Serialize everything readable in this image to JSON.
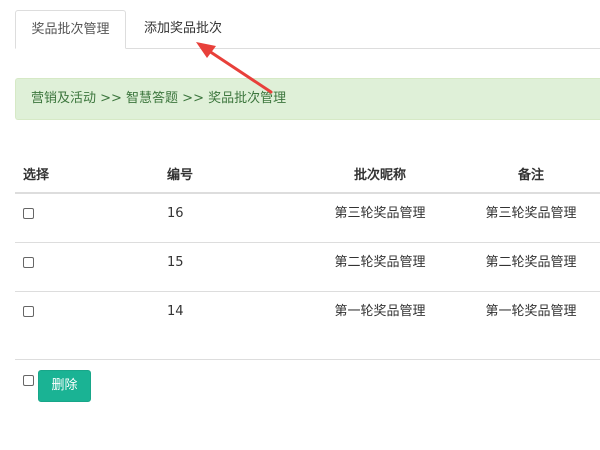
{
  "tabs": [
    {
      "label": "奖品批次管理",
      "active": true
    },
    {
      "label": "添加奖品批次",
      "active": false
    }
  ],
  "breadcrumb": "营销及活动 >> 智慧答题 >> 奖品批次管理",
  "table": {
    "headers": [
      "选择",
      "编号",
      "批次昵称",
      "备注"
    ],
    "rows": [
      {
        "id": "16",
        "name": "第三轮奖品管理",
        "note": "第三轮奖品管理"
      },
      {
        "id": "15",
        "name": "第二轮奖品管理",
        "note": "第二轮奖品管理"
      },
      {
        "id": "14",
        "name": "第一轮奖品管理",
        "note": "第一轮奖品管理"
      }
    ]
  },
  "actions": {
    "delete_label": "删除"
  },
  "colors": {
    "accent": "#1ab394",
    "breadcrumb_bg": "#dff0d8",
    "breadcrumb_text": "#3c763d",
    "arrow": "#e8403a"
  }
}
